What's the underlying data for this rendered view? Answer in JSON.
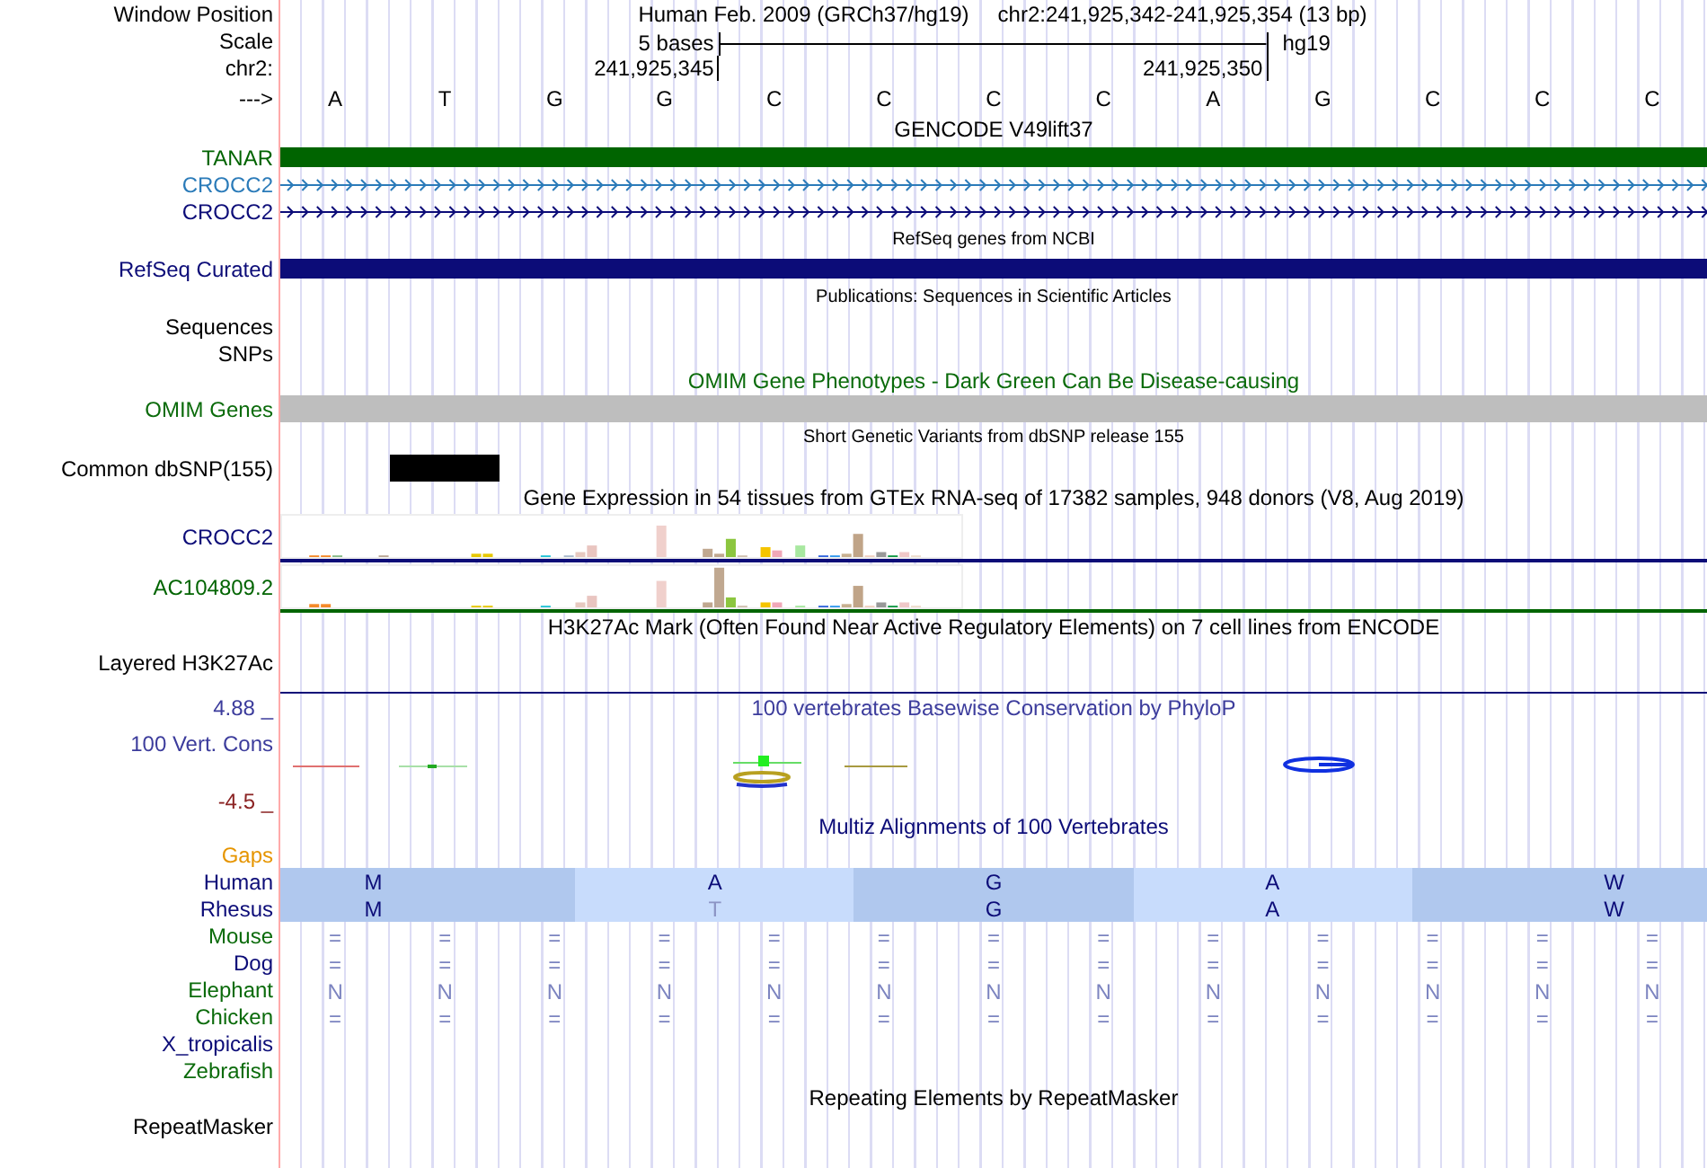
{
  "rows": [
    {
      "kind": "position",
      "label": "Window Position",
      "color": "#000000",
      "assembly": "Human Feb. 2009 (GRCh37/hg19)",
      "range": "chr2:241,925,342-241,925,354 (13 bp)"
    },
    {
      "kind": "scale",
      "label": "Scale",
      "color": "#000000",
      "text": "5 bases",
      "db": "hg19"
    },
    {
      "kind": "coords",
      "label": "chr2:",
      "color": "#000000",
      "ticks": [
        "241,925,345",
        "241,925,350"
      ]
    },
    {
      "kind": "bases",
      "label": "--->",
      "color": "#000000",
      "bases": [
        "A",
        "T",
        "G",
        "G",
        "C",
        "C",
        "C",
        "C",
        "A",
        "G",
        "C",
        "C",
        "C"
      ]
    },
    {
      "kind": "title",
      "text": "GENCODE V49lift37",
      "color": "#000000"
    },
    {
      "kind": "bar",
      "label": "TANAR",
      "color": "#006400"
    },
    {
      "kind": "arrows",
      "label": "CROCC2",
      "color": "#2b7bb9"
    },
    {
      "kind": "arrows",
      "label": "CROCC2",
      "color": "#0c0c78"
    },
    {
      "kind": "subtitle",
      "text": "RefSeq genes from NCBI"
    },
    {
      "kind": "bar",
      "label": "RefSeq Curated",
      "color": "#0c0c78"
    },
    {
      "kind": "subtitle",
      "text": "Publications: Sequences in Scientific Articles"
    },
    {
      "kind": "label",
      "label": "Sequences",
      "color": "#000000"
    },
    {
      "kind": "label",
      "label": "SNPs",
      "color": "#000000"
    },
    {
      "kind": "title",
      "text": "OMIM Gene Phenotypes - Dark Green Can Be Disease-causing",
      "color": "#0b6b0b"
    },
    {
      "kind": "omim",
      "label": "OMIM Genes",
      "color": "#0b6b0b"
    },
    {
      "kind": "subtitle",
      "text": "Short Genetic Variants from dbSNP release 155"
    },
    {
      "kind": "snp",
      "label": "Common dbSNP(155)",
      "color": "#000000"
    },
    {
      "kind": "title",
      "text": "Gene Expression in 54 tissues from GTEx RNA-seq of 17382 samples, 948 donors (V8, Aug 2019)",
      "color": "#000000"
    },
    {
      "kind": "gtex",
      "label": "CROCC2",
      "color": "#0c0c78"
    },
    {
      "kind": "gtex",
      "label": "AC104809.2",
      "color": "#006400"
    },
    {
      "kind": "title",
      "text": "H3K27Ac Mark (Often Found Near Active Regulatory Elements) on 7 cell lines from ENCODE",
      "color": "#000000"
    },
    {
      "kind": "layered",
      "label": "Layered H3K27Ac",
      "color": "#000000"
    },
    {
      "kind": "axis-top",
      "label": "4.88 _",
      "color": "#3c3c9c",
      "title": "100 vertebrates Basewise Conservation by PhyloP"
    },
    {
      "kind": "cons",
      "label": "100 Vert. Cons",
      "color": "#3c3c9c"
    },
    {
      "kind": "axis-bottom",
      "label": "-4.5 _",
      "color": "#8b2323"
    },
    {
      "kind": "title",
      "text": "Multiz Alignments of 100 Vertebrates",
      "color": "#0c0c78"
    },
    {
      "kind": "label",
      "label": "Gaps",
      "color": "#e69500"
    },
    {
      "kind": "codons",
      "label": "Human",
      "color": "#0c0c78",
      "codons": [
        {
          "aa": "M",
          "match": true
        },
        {
          "aa": "A",
          "match": true
        },
        {
          "aa": "G",
          "match": true
        },
        {
          "aa": "A",
          "match": true
        },
        {
          "aa": "W",
          "match": true
        }
      ]
    },
    {
      "kind": "codons",
      "label": "Rhesus",
      "color": "#0c0c78",
      "codons": [
        {
          "aa": "M",
          "match": true
        },
        {
          "aa": "T",
          "match": false
        },
        {
          "aa": "G",
          "match": true
        },
        {
          "aa": "A",
          "match": true
        },
        {
          "aa": "W",
          "match": true
        }
      ]
    },
    {
      "kind": "species",
      "label": "Mouse",
      "color": "#0b6b0b",
      "cells": [
        "=",
        "=",
        "=",
        "=",
        "=",
        "=",
        "=",
        "=",
        "=",
        "=",
        "=",
        "=",
        "="
      ]
    },
    {
      "kind": "species",
      "label": "Dog",
      "color": "#0c0c78",
      "cells": [
        "=",
        "=",
        "=",
        "=",
        "=",
        "=",
        "=",
        "=",
        "=",
        "=",
        "=",
        "=",
        "="
      ]
    },
    {
      "kind": "species",
      "label": "Elephant",
      "color": "#0b6b0b",
      "cells": [
        "N",
        "N",
        "N",
        "N",
        "N",
        "N",
        "N",
        "N",
        "N",
        "N",
        "N",
        "N",
        "N"
      ]
    },
    {
      "kind": "species",
      "label": "Chicken",
      "color": "#0b6b0b",
      "cells": [
        "=",
        "=",
        "=",
        "=",
        "=",
        "=",
        "=",
        "=",
        "=",
        "=",
        "=",
        "=",
        "="
      ]
    },
    {
      "kind": "label",
      "label": "X_tropicalis",
      "color": "#0c0c78"
    },
    {
      "kind": "label",
      "label": "Zebrafish",
      "color": "#0b6b0b"
    },
    {
      "kind": "title",
      "text": "Repeating Elements by RepeatMasker",
      "color": "#000000"
    },
    {
      "kind": "label",
      "label": "RepeatMasker",
      "color": "#000000"
    }
  ]
}
